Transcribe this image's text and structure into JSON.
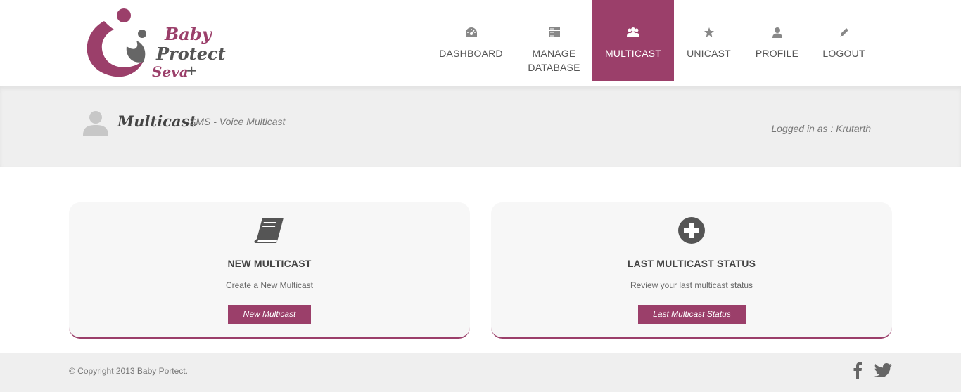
{
  "brand": {
    "line1": "Baby",
    "line2": "Protect",
    "line3": "Seva",
    "plus": "+"
  },
  "nav": {
    "items": [
      {
        "label": "DASHBOARD",
        "icon": "dashboard-icon"
      },
      {
        "label": "MANAGE DATABASE",
        "icon": "database-icon"
      },
      {
        "label": "MULTICAST",
        "icon": "group-icon",
        "active": true
      },
      {
        "label": "UNICAST",
        "icon": "star-icon"
      },
      {
        "label": "PROFILE",
        "icon": "user-icon"
      },
      {
        "label": "LOGOUT",
        "icon": "pencil-icon"
      }
    ]
  },
  "page": {
    "title": "Multicast",
    "subtitle": "SMS - Voice Multicast",
    "logged_in": "Logged in as : Krutarth"
  },
  "cards": [
    {
      "icon": "book-icon",
      "title": "NEW MULTICAST",
      "description": "Create a New Multicast",
      "button": "New Multicast"
    },
    {
      "icon": "plus-circle-icon",
      "title": "LAST MULTICAST STATUS",
      "description": "Review your last multicast status",
      "button": "Last Multicast Status"
    }
  ],
  "footer": {
    "copyright": "© Copyright 2013 Baby Portect.",
    "social": [
      "facebook-icon",
      "twitter-icon"
    ]
  },
  "colors": {
    "accent": "#9b3f6a",
    "band_bg": "#efefef",
    "card_bg": "#f7f7f7"
  }
}
